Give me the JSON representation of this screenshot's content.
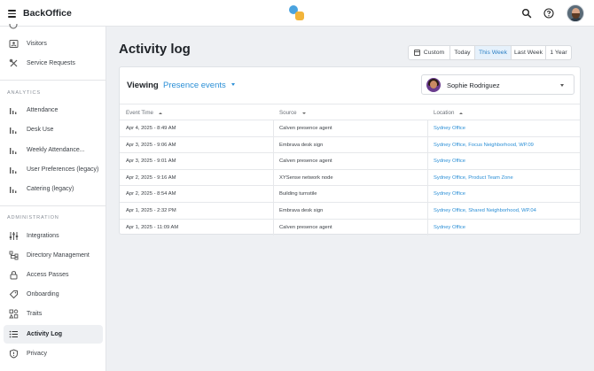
{
  "app": {
    "title": "BackOffice"
  },
  "sidebar": {
    "items_top": [
      {
        "label": "Visitors",
        "icon": "id-card-icon"
      },
      {
        "label": "Service Requests",
        "icon": "tools-icon"
      }
    ],
    "analytics_head": "ANALYTICS",
    "analytics": [
      {
        "label": "Attendance",
        "icon": "bar-chart-icon"
      },
      {
        "label": "Desk Use",
        "icon": "bar-chart-icon"
      },
      {
        "label": "Weekly Attendance...",
        "icon": "bar-chart-icon"
      },
      {
        "label": "User Preferences (legacy)",
        "icon": "bar-chart-icon"
      },
      {
        "label": "Catering (legacy)",
        "icon": "bar-chart-icon"
      }
    ],
    "admin_head": "ADMINISTRATION",
    "admin": [
      {
        "label": "Integrations",
        "icon": "integrations-icon"
      },
      {
        "label": "Directory Management",
        "icon": "directory-icon"
      },
      {
        "label": "Access Passes",
        "icon": "lock-icon"
      },
      {
        "label": "Onboarding",
        "icon": "tag-icon"
      },
      {
        "label": "Traits",
        "icon": "shapes-icon"
      },
      {
        "label": "Activity Log",
        "icon": "list-icon",
        "active": true
      },
      {
        "label": "Privacy",
        "icon": "shield-icon"
      }
    ]
  },
  "main": {
    "title": "Activity log",
    "range": [
      "Custom",
      "Today",
      "This Week",
      "Last Week",
      "1 Year"
    ],
    "range_selected": "This Week",
    "viewing_label": "Viewing",
    "viewing_value": "Presence events",
    "person": "Sophie Rodriguez",
    "columns": [
      "Event Time",
      "Source",
      "Location"
    ],
    "rows": [
      {
        "time": "Apr 4, 2025 - 8:49 AM",
        "source": "Calven presence agent",
        "location": "Sydney Office"
      },
      {
        "time": "Apr 3, 2025 - 9:06 AM",
        "source": "Embrava desk sign",
        "location": "Sydney Office, Focus Neighborhood, WP.09"
      },
      {
        "time": "Apr 3, 2025 - 9:01 AM",
        "source": "Calven presence agent",
        "location": "Sydney Office"
      },
      {
        "time": "Apr 2, 2025 - 9:16 AM",
        "source": "XYSense network node",
        "location": "Sydney Office, Product Team Zone"
      },
      {
        "time": "Apr 2, 2025 - 8:54 AM",
        "source": "Building turnstile",
        "location": "Sydney Office"
      },
      {
        "time": "Apr 1, 2025 - 2:32 PM",
        "source": "Embrava desk sign",
        "location": "Sydney Office, Shared Neighborhood, WP.04"
      },
      {
        "time": "Apr 1, 2025 - 11:09 AM",
        "source": "Calven presence agent",
        "location": "Sydney Office"
      }
    ]
  },
  "colors": {
    "accent": "#2b8fd6",
    "selected_bg": "#e6f1fb",
    "app_bg": "#eef0f3"
  }
}
